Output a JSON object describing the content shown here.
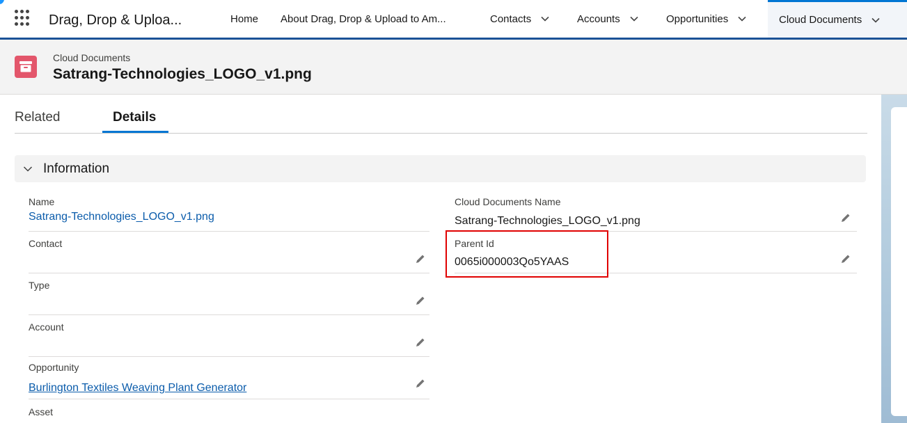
{
  "nav": {
    "app_name": "Drag, Drop & Uploa...",
    "items": [
      {
        "label": "Home",
        "has_menu": false,
        "active": false
      },
      {
        "label": "About Drag, Drop & Upload to Am...",
        "has_menu": false,
        "active": false
      },
      {
        "label": "Contacts",
        "has_menu": true,
        "active": false
      },
      {
        "label": "Accounts",
        "has_menu": true,
        "active": false
      },
      {
        "label": "Opportunities",
        "has_menu": true,
        "active": false
      },
      {
        "label": "Cloud Documents",
        "has_menu": true,
        "active": true
      }
    ],
    "icons": {
      "app_launcher": "waffle-icon",
      "menu": "chevron-down-icon"
    }
  },
  "record": {
    "object_label": "Cloud Documents",
    "title": "Satrang-Technologies_LOGO_v1.png",
    "icon": "archive-icon",
    "icon_color": "#e3566b"
  },
  "tabs": [
    {
      "label": "Related",
      "active": false
    },
    {
      "label": "Details",
      "active": true
    }
  ],
  "section": {
    "label": "Information",
    "icon": "chevron-down-icon"
  },
  "fields": {
    "left": [
      {
        "label": "Name",
        "value": "Satrang-Technologies_LOGO_v1.png",
        "link": true,
        "editable": false
      },
      {
        "label": "Contact",
        "value": "",
        "link": false,
        "editable": true
      },
      {
        "label": "Type",
        "value": "",
        "link": false,
        "editable": true
      },
      {
        "label": "Account",
        "value": "",
        "link": false,
        "editable": true
      },
      {
        "label": "Opportunity",
        "value": "Burlington Textiles Weaving Plant Generator",
        "link": true,
        "editable": true
      },
      {
        "label": "Asset",
        "value": "",
        "link": false,
        "editable": true
      }
    ],
    "right": [
      {
        "label": "Cloud Documents Name",
        "value": "Satrang-Technologies_LOGO_v1.png",
        "link": false,
        "editable": true
      },
      {
        "label": "Parent Id",
        "value": "0065i000003Qo5YAAS",
        "link": false,
        "editable": true,
        "highlighted": true
      }
    ]
  },
  "colors": {
    "brand_blue": "#0176d3",
    "nav_border": "#1b5297",
    "link": "#0b5cab",
    "highlight": "#e00000"
  }
}
